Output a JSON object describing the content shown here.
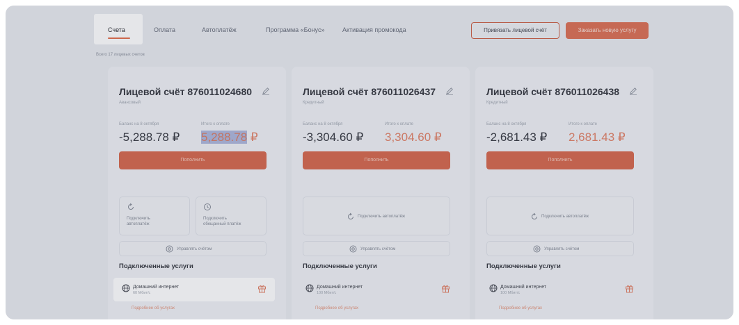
{
  "tabs": [
    "Счета",
    "Оплата",
    "Автоплатёж",
    "Программа «Бонус»",
    "Активация промокода"
  ],
  "actions": {
    "link_account": "Привязать лицевой счёт",
    "order_service": "Заказать новую услугу"
  },
  "total_accounts": "Всего 17 лицевых счетов",
  "labels": {
    "balance": "Баланс на 8 октября",
    "due": "Итого к оплате",
    "pay": "Пополнить",
    "manage": "Управлять счётом",
    "services": "Подключенные услуги",
    "more": "Подробнее об услугах",
    "autopay": "Подключить автоплатёж",
    "autopay_two_line": "Подключить\nавтоплатёж",
    "promised": "Подключить\nобещанный платёж"
  },
  "colors": {
    "accent": "#d45e42",
    "background": "#e7e9ee"
  },
  "accounts": [
    {
      "title": "Лицевой счёт 876011024680",
      "type": "Авансовый",
      "balance": "-5,288.78 ₽",
      "due_value": "5,288.78",
      "due_currency": " ₽",
      "service": {
        "name": "Домашний интернет",
        "speed": "60 Мбит/с"
      }
    },
    {
      "title": "Лицевой счёт 876011026437",
      "type": "Кредитный",
      "balance": "-3,304.60 ₽",
      "due_value": "3,304.60",
      "due_currency": " ₽",
      "service": {
        "name": "Домашний интернет",
        "speed": "100 Мбит/с"
      }
    },
    {
      "title": "Лицевой счёт 876011026438",
      "type": "Кредитный",
      "balance": "-2,681.43 ₽",
      "due_value": "2,681.43",
      "due_currency": " ₽",
      "service": {
        "name": "Домашний интернет",
        "speed": "100 Мбит/с"
      }
    }
  ]
}
